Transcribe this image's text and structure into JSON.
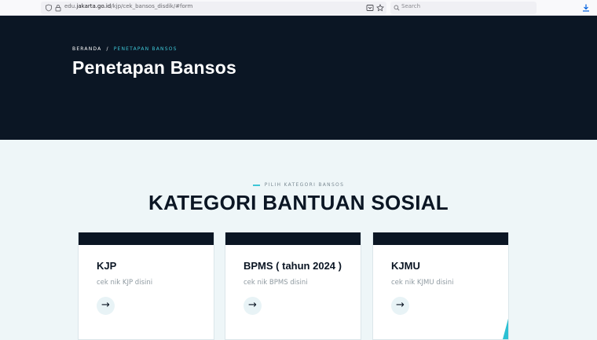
{
  "browser": {
    "url_prefix": "edu.",
    "url_domain": "jakarta.go.id",
    "url_path": "/kjp/cek_bansos_disdik/#form",
    "search_placeholder": "Search"
  },
  "hero": {
    "breadcrumb_home": "BERANDA",
    "breadcrumb_sep": "/",
    "breadcrumb_current": "PENETAPAN BANSOS",
    "title": "Penetapan Bansos"
  },
  "section": {
    "kicker": "PILIH KATEGORI BANSOS",
    "title": "KATEGORI BANTUAN SOSIAL"
  },
  "cards": [
    {
      "title": "KJP",
      "desc": "cek nik KJP disini",
      "arrow": "→"
    },
    {
      "title": "BPMS ( tahun 2024 )",
      "desc": "cek nik BPMS disini",
      "arrow": "→"
    },
    {
      "title": "KJMU",
      "desc": "cek nik KJMU disini",
      "arrow": "→"
    }
  ],
  "colors": {
    "dark": "#0b1624",
    "accent": "#3ec6d6",
    "page_bg": "#eef6f8"
  }
}
